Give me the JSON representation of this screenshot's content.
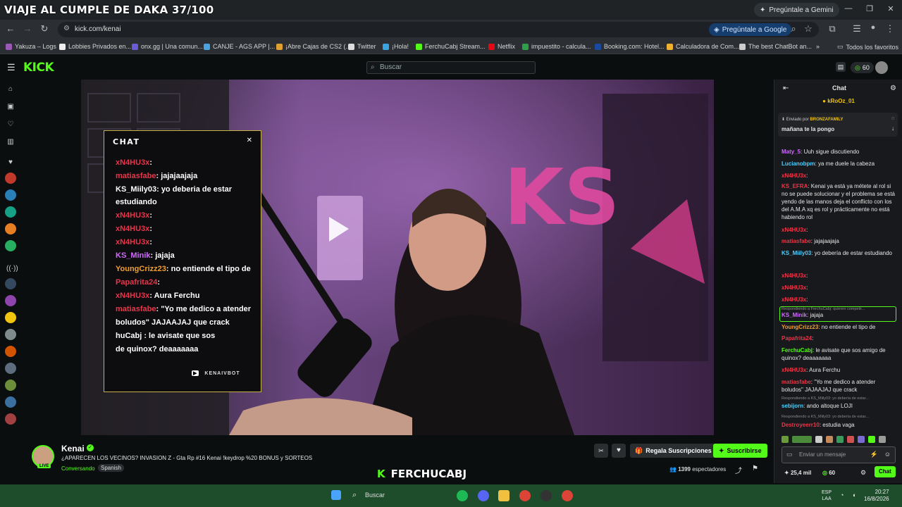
{
  "window": {
    "title": "VIAJE AL CUMPLE DE DAKA 37/100",
    "gemini": "Pregúntale a Gemini"
  },
  "browser": {
    "url": "kick.com/kenai",
    "ask_google": "Pregúntale a Google"
  },
  "bookmarks": [
    "Yakuza – Logs",
    "Lobbies Privados en...",
    "onx.gg | Una comun...",
    "CANJE - AGS APP |...",
    "¡Abre Cajas de CS2 (...",
    "Twitter",
    "¡Hola!",
    "FerchuCabj Stream...",
    "Netflix",
    "impuestito - calcula...",
    "Booking.com: Hotel...",
    "Calculadora de Com...",
    "The best ChatBot an..."
  ],
  "bookmarks_all": "Todos los favoritos",
  "kick": {
    "logo": "KICK",
    "search_placeholder": "Buscar",
    "coins": "60"
  },
  "overlay": {
    "title": "CHAT",
    "lines": [
      {
        "user": "xN4HU3x",
        "text": ":"
      },
      {
        "user": "matiasfabe",
        "text": ": jajajaajaja"
      },
      {
        "user": "KS_Miily03",
        "text": ": yo deberia de estar"
      },
      {
        "user": "",
        "text": "estudiando"
      },
      {
        "user": "xN4HU3x",
        "text": ":"
      },
      {
        "user": "xN4HU3x",
        "text": ":"
      },
      {
        "user": "xN4HU3x",
        "text": ":"
      },
      {
        "user": "KS_Minik",
        "text": ": jajaja"
      },
      {
        "user": "YoungCrizz23",
        "text": ": no entiende el tipo de"
      },
      {
        "user": "Papafrita24",
        "text": ":"
      },
      {
        "user": "xN4HU3x",
        "text": ": Aura Ferchu"
      },
      {
        "user": "matiasfabe",
        "text": ": \"Yo me dedico a atender"
      },
      {
        "user": "",
        "text": "boludos\" JAJAAJAJ que crack"
      },
      {
        "user": "",
        "text": "huCabj : le avisate que sos"
      },
      {
        "user": "",
        "text": "de quinox? deaaaaaaa"
      }
    ],
    "bot": "KENAIVBOT"
  },
  "streamer": {
    "name": "Kenai",
    "live": "LIVE",
    "title": "¿APARECEN LOS VECINOS? INVASION Z - Gta Rp #16 Kenai !keydrop %20 BONUS y SORTEOS",
    "category": "Conversando",
    "language": "Spanish",
    "gift": "Regala Suscripciones",
    "subscribe": "Suscribirse",
    "viewers": "1399",
    "viewers_label": "espectadores"
  },
  "chat": {
    "title": "Chat",
    "pinned_user": "kRoOz_01",
    "pinned_from": "Enviado por",
    "pinned_by": "BRONZAFAMILY",
    "pinned_msg": "mañana te la pongo",
    "messages": [
      {
        "user": "Maty_5",
        "text": ": Uuh sigue discutiendo"
      },
      {
        "user": "Lucianobpm",
        "text": ": ya me duele la cabeza"
      },
      {
        "user": "xN4HU3x",
        "text": ":"
      },
      {
        "user": "KS_EFRA",
        "text": ": Kenai ya está ya métete al rol si no se puede solucionar y el problema se está yendo de las manos deja el conflicto con los del A.M.A xq es rol y prácticamente no está habiendo rol"
      },
      {
        "user": "xN4HU3x",
        "text": ":"
      },
      {
        "user": "matiasfabe",
        "text": ": jajajaajaja"
      },
      {
        "user": "KS_Miily03",
        "text": ": yo debería de estar estudiando"
      },
      {
        "user": "xN4HU3x",
        "text": ":"
      },
      {
        "user": "xN4HU3x",
        "text": ":"
      },
      {
        "user": "xN4HU3x",
        "text": ":"
      },
      {
        "user": "KS_Minik",
        "text": ": jajaja"
      },
      {
        "user": "YoungCrizz23",
        "text": ": no entiende el tipo de"
      },
      {
        "user": "Papafrita24",
        "text": ":"
      },
      {
        "user": "FerchuCabj",
        "text": ": le avisate que sos amigo de quinox? deaaaaaaa"
      },
      {
        "user": "xN4HU3x",
        "text": ": Aura Ferchu"
      },
      {
        "user": "matiasfabe",
        "text": ": \"Yo me dedico a atender boludos\" JAJAAJAJ que crack"
      },
      {
        "user": "sebijorn",
        "text": ": ando altoque LOJI"
      },
      {
        "user": "Destroyeerr10",
        "text": ": estudia vaga"
      }
    ],
    "reply1": "Respondiendo a FerchuCabj: quieren competir...",
    "reply2": "Respondiendo a KS_Miily03: yo debería de estar...",
    "reply3": "Respondiendo a KS_Miily03: yo debería de estar...",
    "input_placeholder": "Enviar un mensaje",
    "points": "25,4 mil",
    "coins": "60",
    "send": "Chat"
  },
  "watermark": "FERCHUCABJ",
  "taskbar": {
    "search": "Buscar",
    "lang": "ESP",
    "lang2": "LAA",
    "time": "20:27",
    "date": "16/8/2026"
  }
}
